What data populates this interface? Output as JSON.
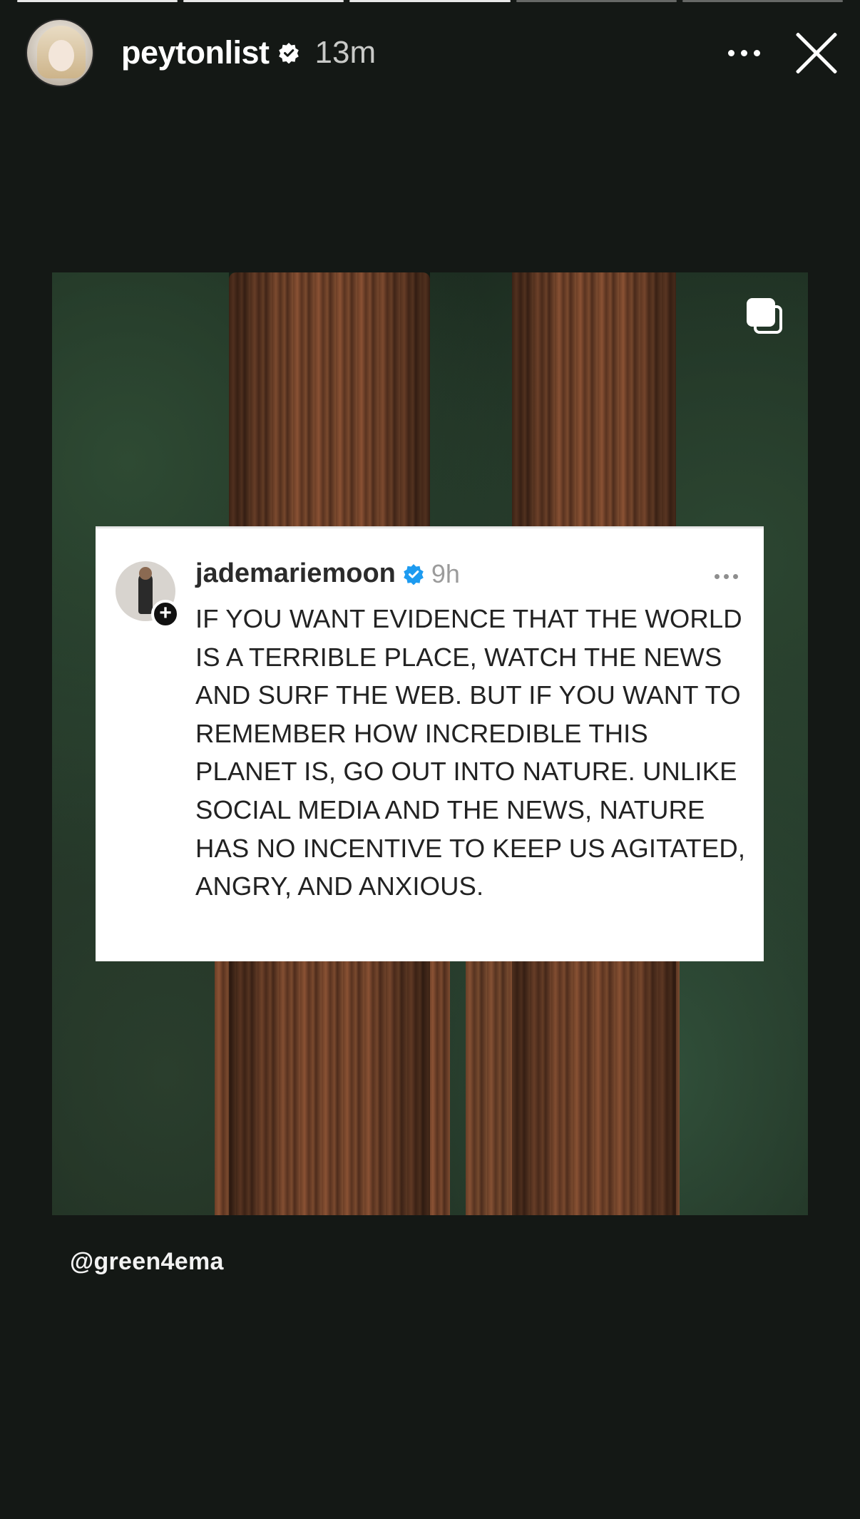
{
  "story": {
    "progress_segments": [
      {
        "done": true
      },
      {
        "done": true
      },
      {
        "done": true
      },
      {
        "done": false
      },
      {
        "done": false
      }
    ],
    "header": {
      "username": "peytonlist",
      "time_ago": "13m",
      "verified_icon": "verified-badge-icon",
      "more_icon": "more-dots-icon",
      "close_icon": "close-icon"
    },
    "shared_post": {
      "multi_icon": "carousel-icon",
      "card": {
        "username": "jademariemoon",
        "time_ago": "9h",
        "text": "IF YOU WANT EVIDENCE THAT THE WORLD IS A TERRIBLE PLACE, WATCH THE NEWS AND SURF THE WEB. BUT IF YOU WANT TO REMEMBER HOW INCREDIBLE THIS PLANET IS, GO OUT INTO NATURE. UNLIKE SOCIAL MEDIA AND THE NEWS, NATURE HAS NO INCENTIVE TO KEEP US AGITATED, ANGRY, AND ANXIOUS.",
        "plus_label": "+",
        "verified_color": "#1d9bf0"
      }
    },
    "mention": "@green4ema"
  }
}
